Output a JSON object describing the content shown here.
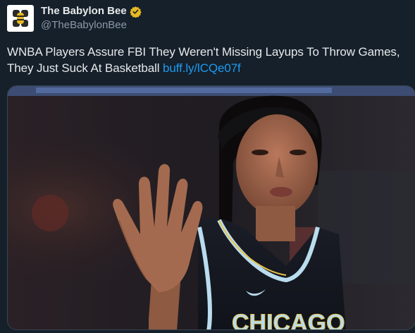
{
  "account": {
    "display_name": "The Babylon Bee",
    "handle": "@TheBabylonBee",
    "verified": true,
    "avatar_icon": "bee-logo-icon",
    "verified_icon": "verified-badge-icon"
  },
  "tweet": {
    "text": "WNBA Players Assure FBI They Weren't Missing Layups To Throw Games, They Just Suck At Basketball",
    "link": "buff.ly/lCQe07f"
  },
  "media": {
    "jersey_text": "CHICAGO"
  },
  "colors": {
    "background": "#15202b",
    "text": "#e7e9ea",
    "secondary_text": "#8b98a5",
    "link": "#1d9bf0",
    "verified_badge": "#e8b923"
  }
}
